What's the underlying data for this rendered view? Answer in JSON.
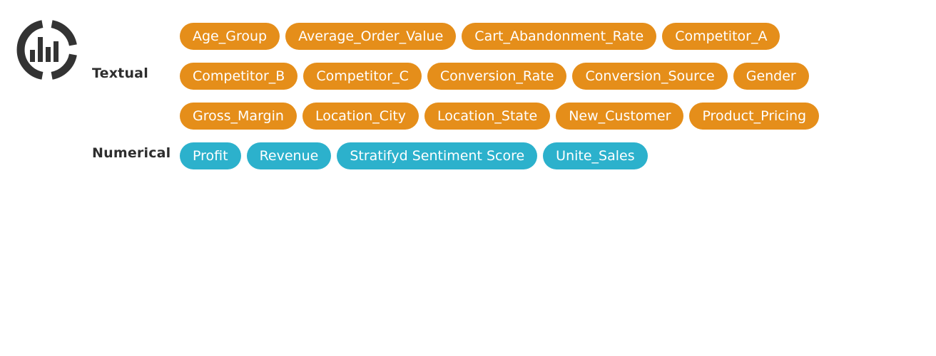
{
  "colors": {
    "textual_tag": "#e58e1a",
    "numerical_tag": "#2cb1cc",
    "label_text": "#2e2e2e",
    "logo": "#333333"
  },
  "logo": {
    "icon": "bar-chart-ring-icon"
  },
  "groups": {
    "textual": {
      "label": "Textual",
      "rows": [
        [
          "Age_Group",
          "Average_Order_Value",
          "Cart_Abandonment_Rate",
          "Competitor_A"
        ],
        [
          "Competitor_B",
          "Competitor_C",
          "Conversion_Rate",
          "Conversion_Source",
          "Gender"
        ],
        [
          "Gross_Margin",
          "Location_City",
          "Location_State",
          "New_Customer",
          "Product_Pricing"
        ]
      ]
    },
    "numerical": {
      "label": "Numerical",
      "rows": [
        [
          "Profit",
          "Revenue",
          "Stratifyd Sentiment Score",
          "Unite_Sales"
        ]
      ]
    }
  }
}
